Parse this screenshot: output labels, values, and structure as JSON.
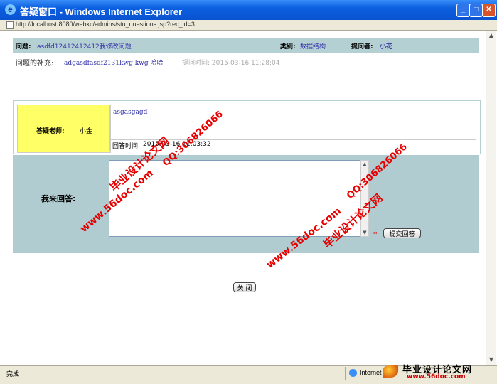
{
  "window": {
    "title": "答疑窗口 - Windows Internet Explorer",
    "icon": "ie-icon",
    "controls": [
      "minimize",
      "maximize",
      "close"
    ]
  },
  "address": {
    "url": "http://localhost:8080/webkc/admins/stu_questions.jsp?rec_id=3"
  },
  "question": {
    "title_label": "问题:",
    "title_value": "asdfd12412412412我修改问题",
    "category_label": "类别:",
    "category_value": "数据结构",
    "asker_label": "提问者:",
    "asker_value": "小花",
    "supplement_label": "问题的补充:",
    "supplement_value": "adgasdfasdf2131kwg kwg 哈哈",
    "ask_time": "提问时间: 2015-03-16 11:28:04"
  },
  "answer": {
    "teacher_label": "答疑老师:",
    "teacher_value": "小金",
    "content": "asgasgagd",
    "time_label": "回答时间:",
    "time_value": "2015-03-16 11:03:32"
  },
  "reply": {
    "label": "我来回答:",
    "required_mark": "*",
    "submit_label": "提交回答"
  },
  "close_label": "关 闭",
  "status": {
    "text": "完成",
    "zone": "Internet"
  },
  "branding": {
    "name": "毕业设计论文网",
    "site": "www.56doc.com"
  },
  "watermarks": {
    "a1": "毕业设计论文网",
    "a2": "QQ:306826066",
    "a3": "www.56doc.com",
    "b1": "QQ:306826066",
    "b2": "毕业设计论文网",
    "b3": "www.56doc.com"
  },
  "colors": {
    "titlebar": "#0b5fe0",
    "header_band": "#b5d0d2",
    "teacher_bg": "#ffff66",
    "link_text": "#3333aa",
    "required": "#e00000",
    "watermark": "#e60000"
  }
}
